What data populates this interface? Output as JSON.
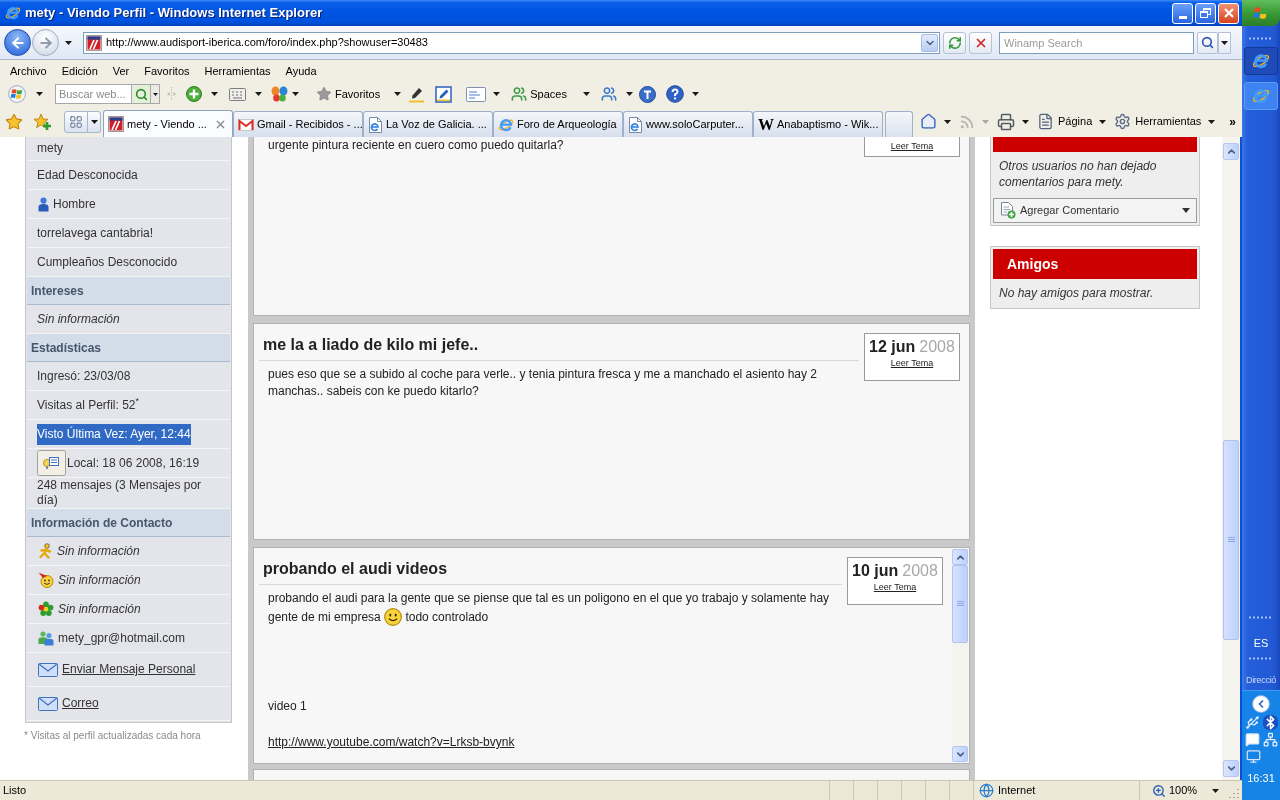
{
  "window": {
    "title": "mety - Viendo Perfil - Windows Internet Explorer"
  },
  "nav_buttons": [
    {
      "kind": "back",
      "disabled": false
    },
    {
      "kind": "forward",
      "disabled": true
    }
  ],
  "address_bar": {
    "url": "http://www.audisport-iberica.com/foro/index.php?showuser=30483"
  },
  "search": {
    "placeholder": "Winamp Search"
  },
  "menu": [
    "Archivo",
    "Edición",
    "Ver",
    "Favoritos",
    "Herramientas",
    "Ayuda"
  ],
  "toolbar": {
    "search_placeholder": "Buscar web...",
    "favorites": "Favoritos",
    "spaces": "Spaces"
  },
  "tabs": [
    {
      "kind": "site",
      "label": "mety - Viendo ...",
      "selected": true
    },
    {
      "kind": "gmail",
      "label": "Gmail - Recibidos - ...",
      "selected": false
    },
    {
      "kind": "page",
      "label": "La Voz de Galicia. ...",
      "selected": false
    },
    {
      "kind": "browser",
      "label": "Foro de Arqueología",
      "selected": false
    },
    {
      "kind": "page",
      "label": "www.soloCarputer...",
      "selected": false
    },
    {
      "kind": "glyph",
      "glyph": "W",
      "label": "Anabaptismo - Wik...",
      "selected": false
    }
  ],
  "command_bar": {
    "items": [
      {
        "kind": "home",
        "disabled": false
      },
      {
        "kind": "feeds",
        "disabled": true
      },
      {
        "kind": "print",
        "disabled": false
      },
      {
        "kind": "page",
        "label": "Página",
        "disabled": false
      },
      {
        "kind": "tools",
        "label": "Herramientas",
        "disabled": false
      }
    ],
    "more": "»"
  },
  "sidebar": {
    "sections": [
      {
        "rows": [
          {
            "kind": "plain",
            "text": "mety",
            "empty": false,
            "highlighted": false
          },
          {
            "kind": "plain",
            "text": "Edad Desconocida",
            "empty": false,
            "highlighted": false
          },
          {
            "kind": "user",
            "text": "Hombre",
            "empty": false,
            "highlighted": false
          },
          {
            "kind": "plain",
            "text": "torrelavega cantabria!",
            "empty": false,
            "highlighted": false
          },
          {
            "kind": "plain",
            "text": "Cumpleaños Desconocido",
            "empty": false,
            "highlighted": false
          }
        ]
      },
      {
        "title": "Intereses",
        "rows": [
          {
            "kind": "plain",
            "text": "Sin información",
            "empty": true,
            "highlighted": false
          }
        ]
      },
      {
        "title": "Estadísticas",
        "rows": [
          {
            "kind": "plain",
            "text": "Ingresó: 23/03/08",
            "empty": false,
            "highlighted": false
          },
          {
            "kind": "plain",
            "text": "Visitas al Perfil: 52$^{*}$",
            "empty": false,
            "highlighted": false
          },
          {
            "kind": "plain",
            "text": "Visto Última Vez: Ayer, 12:44",
            "empty": false,
            "highlighted": true
          },
          {
            "kind": "local",
            "text": "Local: 18 06 2008, 16:19",
            "empty": false,
            "highlighted": false
          },
          {
            "kind": "plain",
            "text": "248 mensajes (3 Mensajes por día)",
            "empty": false,
            "highlighted": false
          }
        ]
      },
      {
        "title": "Información de Contacto",
        "rows": [
          {
            "kind": "aim",
            "text": "Sin información",
            "empty": true,
            "highlighted": false
          },
          {
            "kind": "yahoo",
            "text": "Sin información",
            "empty": true,
            "highlighted": false
          },
          {
            "kind": "icq",
            "text": "Sin información",
            "empty": true,
            "highlighted": false
          },
          {
            "kind": "msn",
            "text": "mety_gpr@hotmail.com",
            "empty": false,
            "highlighted": false
          },
          {
            "kind": "mail",
            "text": "Enviar Mensaje Personal",
            "empty": false,
            "highlighted": false
          },
          {
            "kind": "mail",
            "text": "Correo",
            "empty": false,
            "highlighted": false
          }
        ]
      }
    ],
    "footnote": "* Visitas al perfil actualizadas cada hora"
  },
  "posts": [
    {
      "date": {
        "link": "Leer Tema"
      },
      "scrollbar": false,
      "paragraphs": [
        [
          [
            {
              "kind": "text",
              "text": "urgente pintura reciente en cuero como puedo quitarla?"
            }
          ]
        ]
      ]
    },
    {
      "title": "me la a liado de kilo mi jefe..",
      "date": {
        "day": "12 jun",
        "year": "2008",
        "link": "Leer Tema"
      },
      "scrollbar": false,
      "paragraphs": [
        [
          [
            {
              "kind": "text",
              "text": "pues eso que se a subido al coche para verle.. y tenia pintura fresca y me a manchado el asiento hay 2 manchas.. sabeis con ke puedo kitarlo?"
            }
          ]
        ]
      ]
    },
    {
      "title": "probando el audi videos",
      "date": {
        "day": "10 jun",
        "year": "2008",
        "link": "Leer Tema"
      },
      "scrollbar": true,
      "paragraphs": [
        [
          [
            {
              "kind": "text",
              "text": "probando el audi para la gente que se piense que tal es un poligono en el que yo trabajo y solamente hay"
            }
          ],
          [
            {
              "kind": "text",
              "text": "gente de mi empresa"
            },
            {
              "kind": "smiley"
            },
            {
              "kind": "text",
              "text": "todo controlado"
            }
          ]
        ],
        [
          [
            {
              "kind": "text",
              "text": "video 1"
            }
          ]
        ],
        [
          [
            {
              "kind": "link",
              "text": "http://www.youtube.com/watch?v=Lrksb-bvynk"
            }
          ]
        ]
      ]
    }
  ],
  "comments": {
    "text": "Otros usuarios no han dejado comentarios para mety.",
    "button": "Agregar Comentario"
  },
  "friends": {
    "title": "Amigos",
    "text": "No hay amigos para mostrar."
  },
  "status_bar": {
    "text": "Listo",
    "zone": "Internet",
    "zoom": "100%"
  },
  "taskbar": {
    "buttons": [
      {
        "selected": true
      },
      {
        "selected": false
      }
    ],
    "language": "ES",
    "toolbar_label": "Direcció",
    "clock": "16:31"
  }
}
